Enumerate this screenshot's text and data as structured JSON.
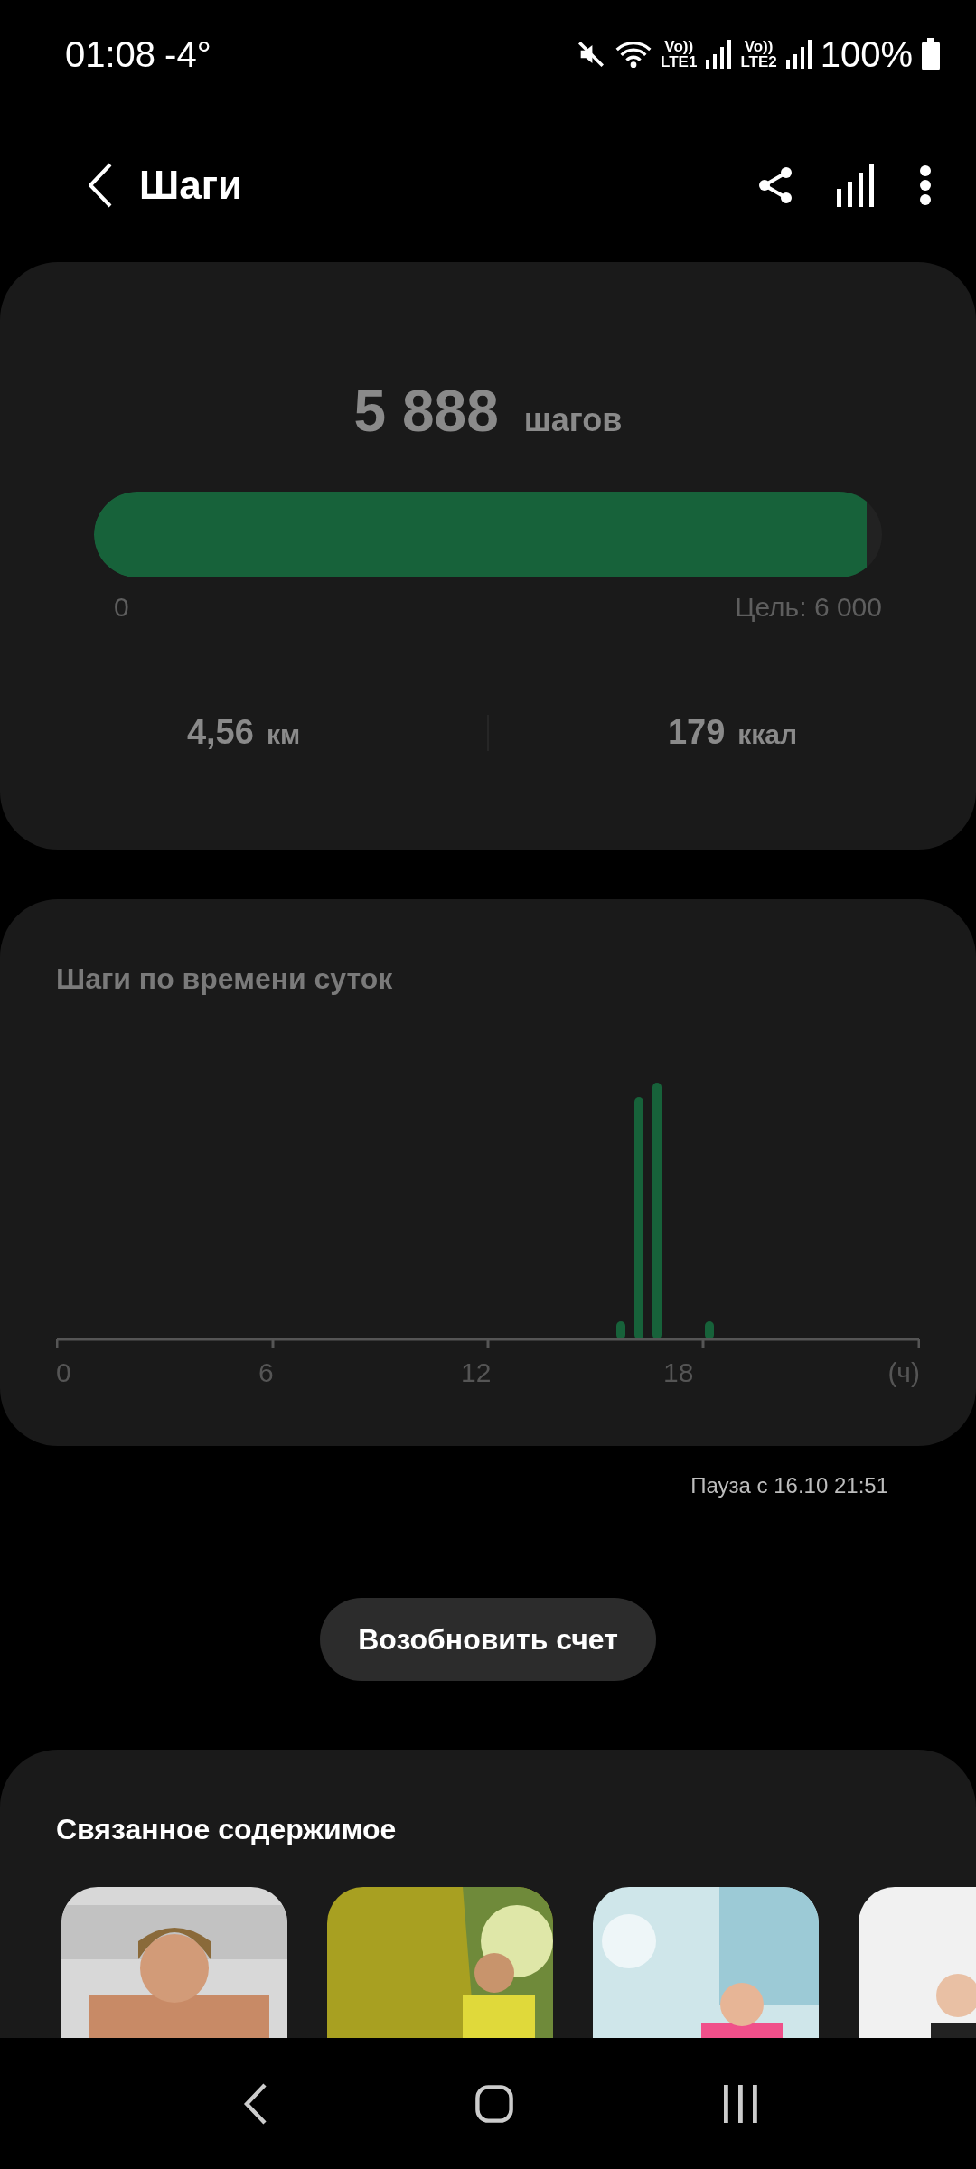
{
  "status_bar": {
    "time": "01:08",
    "temperature": "-4°",
    "sims": [
      {
        "volte": "Vo))",
        "network": "LTE1"
      },
      {
        "volte": "Vo))",
        "network": "LTE2"
      }
    ],
    "battery": "100%"
  },
  "header": {
    "title": "Шаги"
  },
  "summary": {
    "steps": "5 888",
    "steps_unit": "шагов",
    "level": 0.98,
    "scale_start": "0",
    "goal": "Цель: 6 000",
    "distance": "4,56",
    "distance_unit": "км",
    "calories": "179",
    "calories_unit": "ккал"
  },
  "hourly": {
    "title": "Шаги по времени суток",
    "axis_labels": [
      "0",
      "6",
      "12",
      "18",
      "(ч)"
    ]
  },
  "pause_note": "Пауза с 16.10 21:51",
  "resume_button": "Возобновить счет",
  "related": {
    "title": "Связанное содержимое"
  }
}
